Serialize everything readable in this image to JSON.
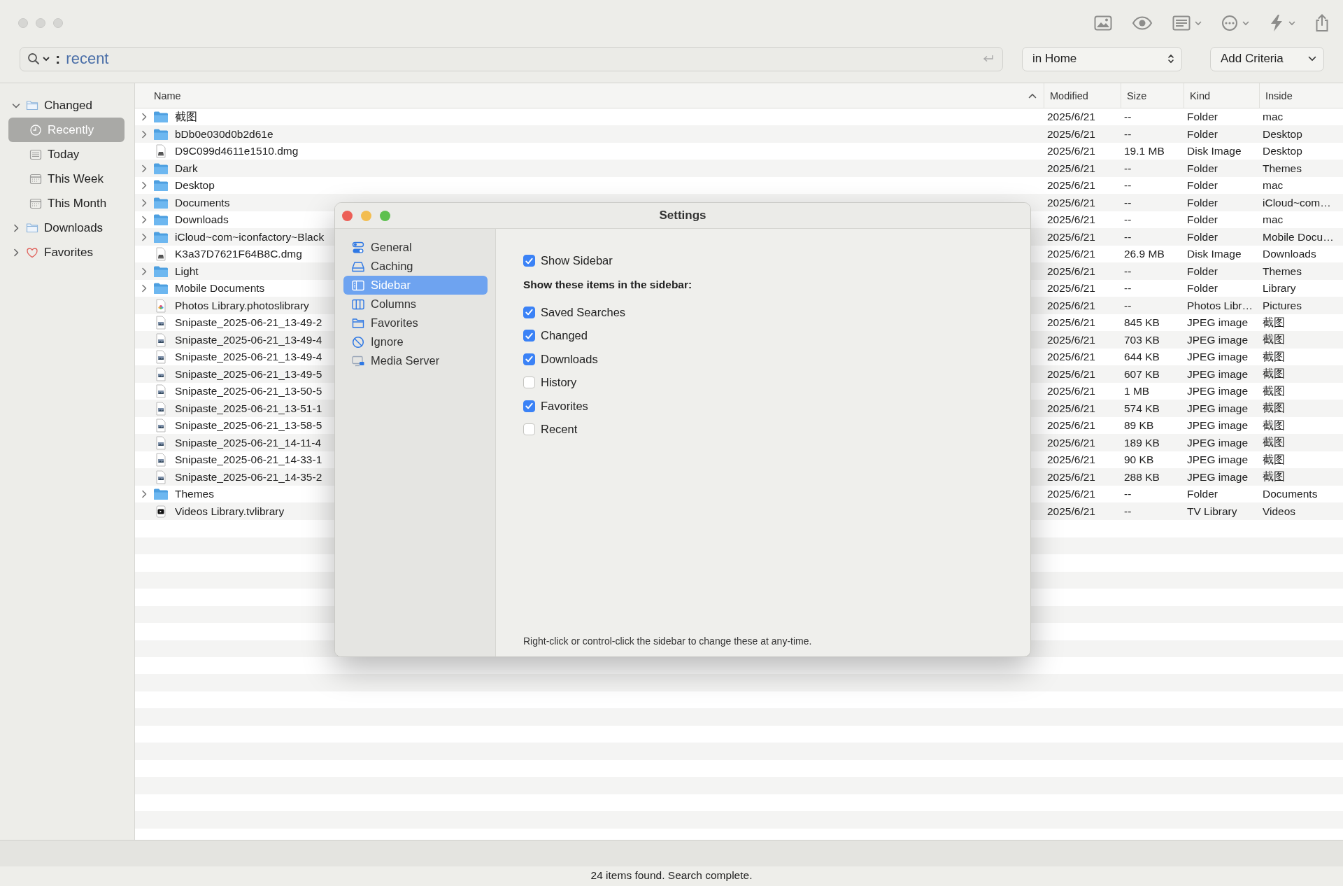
{
  "search": {
    "separator": ":",
    "value": "recent",
    "scope": "in Home",
    "add_criteria": "Add Criteria"
  },
  "sidebar": {
    "items": [
      {
        "label": "Changed",
        "kind": "folder",
        "expanded": true,
        "selected": false,
        "children": [
          {
            "label": "Recently",
            "kind": "clock",
            "selected": true
          },
          {
            "label": "Today",
            "kind": "list",
            "selected": false
          },
          {
            "label": "This Week",
            "kind": "calendar",
            "selected": false
          },
          {
            "label": "This Month",
            "kind": "calendar",
            "selected": false
          }
        ]
      },
      {
        "label": "Downloads",
        "kind": "folder",
        "expanded": false,
        "selected": false
      },
      {
        "label": "Favorites",
        "kind": "heart",
        "expanded": false,
        "selected": false
      }
    ]
  },
  "table": {
    "columns": [
      {
        "label": "Name",
        "sorted": true
      },
      {
        "label": "Modified",
        "sorted": false
      },
      {
        "label": "Size",
        "sorted": false
      },
      {
        "label": "Kind",
        "sorted": false
      },
      {
        "label": "Inside",
        "sorted": false
      }
    ],
    "rows": [
      {
        "kind": "folder",
        "cells": [
          "截图",
          "2025/6/21",
          "--",
          "Folder",
          "mac"
        ]
      },
      {
        "kind": "folder",
        "cells": [
          "bDb0e030d0b2d61e",
          "2025/6/21",
          "--",
          "Folder",
          "Desktop"
        ]
      },
      {
        "kind": "disk-image",
        "cells": [
          "D9C099d4611e1510.dmg",
          "2025/6/21",
          "19.1 MB",
          "Disk Image",
          "Desktop"
        ]
      },
      {
        "kind": "folder",
        "cells": [
          "Dark",
          "2025/6/21",
          "--",
          "Folder",
          "Themes"
        ]
      },
      {
        "kind": "folder",
        "cells": [
          "Desktop",
          "2025/6/21",
          "--",
          "Folder",
          "mac"
        ]
      },
      {
        "kind": "folder",
        "cells": [
          "Documents",
          "2025/6/21",
          "--",
          "Folder",
          "iCloud~com…"
        ]
      },
      {
        "kind": "folder",
        "cells": [
          "Downloads",
          "2025/6/21",
          "--",
          "Folder",
          "mac"
        ]
      },
      {
        "kind": "folder",
        "cells": [
          "iCloud~com~iconfactory~Black",
          "2025/6/21",
          "--",
          "Folder",
          "Mobile Docu…"
        ]
      },
      {
        "kind": "disk-image",
        "cells": [
          "K3a37D7621F64B8C.dmg",
          "2025/6/21",
          "26.9 MB",
          "Disk Image",
          "Downloads"
        ]
      },
      {
        "kind": "folder",
        "cells": [
          "Light",
          "2025/6/21",
          "--",
          "Folder",
          "Themes"
        ]
      },
      {
        "kind": "folder",
        "cells": [
          "Mobile Documents",
          "2025/6/21",
          "--",
          "Folder",
          "Library"
        ]
      },
      {
        "kind": "photos-library",
        "cells": [
          "Photos Library.photoslibrary",
          "2025/6/21",
          "--",
          "Photos Libr…",
          "Pictures"
        ]
      },
      {
        "kind": "image",
        "cells": [
          "Snipaste_2025-06-21_13-49-2",
          "2025/6/21",
          "845 KB",
          "JPEG image",
          "截图"
        ]
      },
      {
        "kind": "image",
        "cells": [
          "Snipaste_2025-06-21_13-49-4",
          "2025/6/21",
          "703 KB",
          "JPEG image",
          "截图"
        ]
      },
      {
        "kind": "image",
        "cells": [
          "Snipaste_2025-06-21_13-49-4",
          "2025/6/21",
          "644 KB",
          "JPEG image",
          "截图"
        ]
      },
      {
        "kind": "image",
        "cells": [
          "Snipaste_2025-06-21_13-49-5",
          "2025/6/21",
          "607 KB",
          "JPEG image",
          "截图"
        ]
      },
      {
        "kind": "image",
        "cells": [
          "Snipaste_2025-06-21_13-50-5",
          "2025/6/21",
          "1 MB",
          "JPEG image",
          "截图"
        ]
      },
      {
        "kind": "image",
        "cells": [
          "Snipaste_2025-06-21_13-51-1",
          "2025/6/21",
          "574 KB",
          "JPEG image",
          "截图"
        ]
      },
      {
        "kind": "image",
        "cells": [
          "Snipaste_2025-06-21_13-58-5",
          "2025/6/21",
          "89 KB",
          "JPEG image",
          "截图"
        ]
      },
      {
        "kind": "image",
        "cells": [
          "Snipaste_2025-06-21_14-11-4",
          "2025/6/21",
          "189 KB",
          "JPEG image",
          "截图"
        ]
      },
      {
        "kind": "image",
        "cells": [
          "Snipaste_2025-06-21_14-33-1",
          "2025/6/21",
          "90 KB",
          "JPEG image",
          "截图"
        ]
      },
      {
        "kind": "image",
        "cells": [
          "Snipaste_2025-06-21_14-35-2",
          "2025/6/21",
          "288 KB",
          "JPEG image",
          "截图"
        ]
      },
      {
        "kind": "folder",
        "cells": [
          "Themes",
          "2025/6/21",
          "--",
          "Folder",
          "Documents"
        ]
      },
      {
        "kind": "tv-library",
        "cells": [
          "Videos Library.tvlibrary",
          "2025/6/21",
          "--",
          "TV Library",
          "Videos"
        ]
      }
    ]
  },
  "status_bar": "24 items found. Search complete.",
  "settings": {
    "title": "Settings",
    "nav": [
      {
        "label": "General",
        "kind": "toggles",
        "selected": false
      },
      {
        "label": "Caching",
        "kind": "drive",
        "selected": false
      },
      {
        "label": "Sidebar",
        "kind": "sidebar",
        "selected": true
      },
      {
        "label": "Columns",
        "kind": "columns",
        "selected": false
      },
      {
        "label": "Favorites",
        "kind": "folder",
        "selected": false
      },
      {
        "label": "Ignore",
        "kind": "ignore",
        "selected": false
      },
      {
        "label": "Media Server",
        "kind": "monitor",
        "selected": false
      }
    ],
    "show_sidebar": {
      "label": "Show Sidebar",
      "checked": true
    },
    "section_title": "Show these items in the sidebar:",
    "items": [
      {
        "label": "Saved Searches",
        "checked": true
      },
      {
        "label": "Changed",
        "checked": true
      },
      {
        "label": "Downloads",
        "checked": true
      },
      {
        "label": "History",
        "checked": false
      },
      {
        "label": "Favorites",
        "checked": true
      },
      {
        "label": "Recent",
        "checked": false
      }
    ],
    "footnote": "Right-click or control-click the sidebar to change these at any-time."
  }
}
